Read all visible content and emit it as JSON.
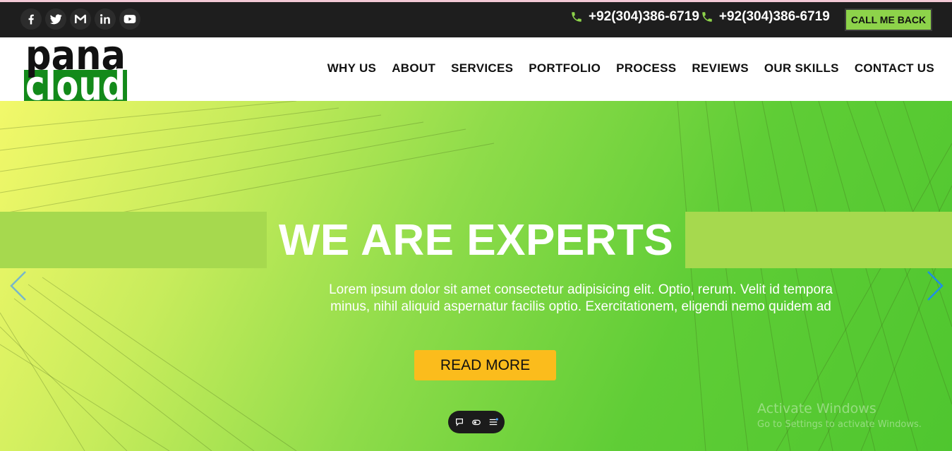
{
  "topbar": {
    "social_icons": [
      "facebook-icon",
      "twitter-icon",
      "gmail-icon",
      "linkedin-icon",
      "youtube-icon"
    ],
    "phones": [
      "+92(304)386-6719",
      "+92(304)386-6719"
    ],
    "call_button": "CALL ME BACK"
  },
  "logo": {
    "line1": "pana",
    "line2": "cloud"
  },
  "nav": {
    "items": [
      "WHY US",
      "ABOUT",
      "SERVICES",
      "PORTFOLIO",
      "PROCESS",
      "REVIEWS",
      "OUR SKILLS",
      "CONTACT US"
    ]
  },
  "hero": {
    "title": "WE ARE EXPERTS",
    "text_line1": "Lorem ipsum dolor sit amet consectetur adipisicing elit. Optio, rerum. Velit id tempora",
    "text_line2": "minus, nihil aliquid aspernatur facilis optio. Exercitationem, eligendi nemo quidem ad",
    "button": "READ MORE"
  },
  "watermark": {
    "line1": "Activate Windows",
    "line2": "Go to Settings to activate Windows."
  },
  "colors": {
    "topbar_bg": "#1e1e1e",
    "accent_green": "#8dd34a",
    "logo_green": "#138a1a",
    "button_yellow": "#fbbc1c",
    "band_green": "#a6d94e"
  }
}
